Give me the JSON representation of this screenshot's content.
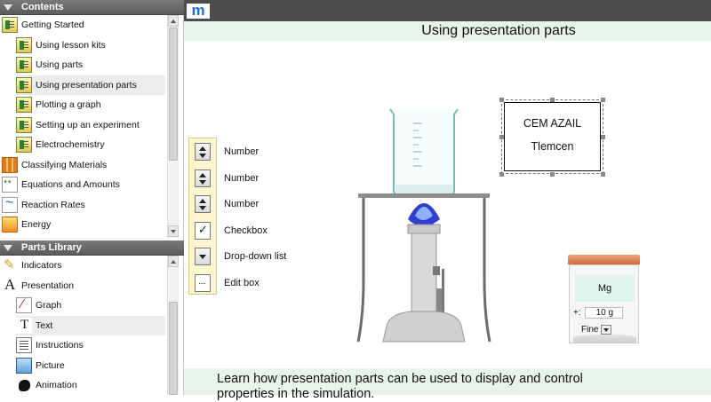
{
  "left_panel": {
    "contents_header": "Contents",
    "contents_items": [
      {
        "label": "Getting Started",
        "icon": "folder-icon",
        "indent": 0
      },
      {
        "label": "Using lesson kits",
        "icon": "document-icon",
        "indent": 1
      },
      {
        "label": "Using parts",
        "icon": "document-icon",
        "indent": 1
      },
      {
        "label": "Using presentation parts",
        "icon": "document-icon",
        "indent": 1,
        "selected": true
      },
      {
        "label": "Plotting a graph",
        "icon": "document-icon",
        "indent": 1
      },
      {
        "label": "Setting up an experiment",
        "icon": "document-icon",
        "indent": 1
      },
      {
        "label": "Electrochemistry",
        "icon": "document-icon",
        "indent": 1
      },
      {
        "label": "Classifying Materials",
        "icon": "grid-icon",
        "indent": 0
      },
      {
        "label": "Equations and Amounts",
        "icon": "chain-icon",
        "indent": 0
      },
      {
        "label": "Reaction Rates",
        "icon": "wave-icon",
        "indent": 0
      },
      {
        "label": "Energy",
        "icon": "flame-icon",
        "indent": 0
      }
    ],
    "library_header": "Parts Library",
    "library_items": [
      {
        "label": "Indicators",
        "icon": "pen-icon",
        "indent": 0
      },
      {
        "label": "Presentation",
        "icon": "letter-a-icon",
        "indent": 0
      },
      {
        "label": "Graph",
        "icon": "graph-icon",
        "indent": 1
      },
      {
        "label": "Text",
        "icon": "text-icon",
        "indent": 1,
        "selected": true
      },
      {
        "label": "Instructions",
        "icon": "instructions-icon",
        "indent": 1
      },
      {
        "label": "Picture",
        "icon": "picture-icon",
        "indent": 1
      },
      {
        "label": "Animation",
        "icon": "animation-icon",
        "indent": 1
      }
    ]
  },
  "main": {
    "logo": "m",
    "title": "Using presentation parts",
    "controls": [
      {
        "label": "Number",
        "icon": "spinner-icon"
      },
      {
        "label": "Number",
        "icon": "spinner-icon"
      },
      {
        "label": "Number",
        "icon": "spinner-icon"
      },
      {
        "label": "Checkbox",
        "icon": "checkbox-icon"
      },
      {
        "label": "Drop-down list",
        "icon": "dropdown-icon"
      },
      {
        "label": "Edit box",
        "icon": "editbox-icon"
      }
    ],
    "text_box": {
      "line1": "CEM AZAIL",
      "line2": "Tlemcen"
    },
    "jar": {
      "substance": "Mg",
      "amount_prefix": "+:",
      "amount": "10 g",
      "grain": "Fine"
    },
    "footer": "Learn how presentation parts can be used to display and control properties in the simulation."
  },
  "colors": {
    "header_bg": "#5b5b5b",
    "strip_bg": "#e8f3ea",
    "flame": "#2f3fd0",
    "jar_lid": "#d9784a"
  }
}
